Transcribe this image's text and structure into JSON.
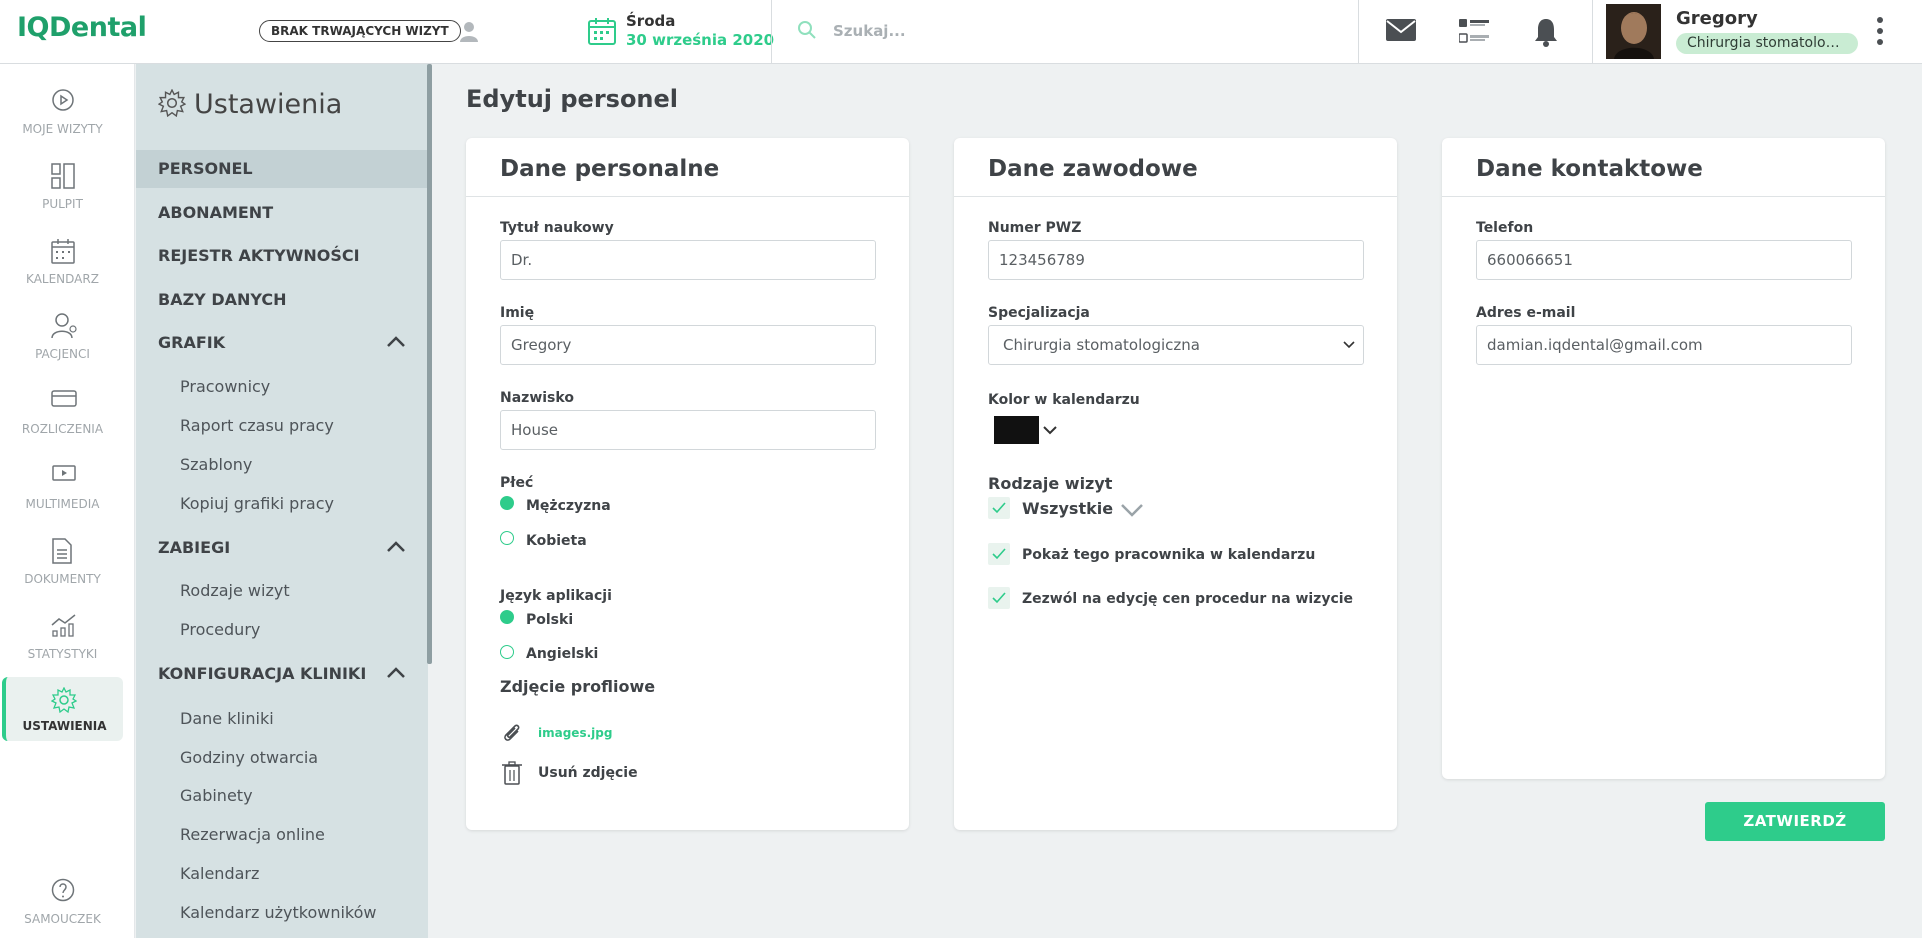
{
  "header": {
    "logo": "IQDental",
    "visit_pill": "BRAK TRWAJĄCYCH WIZYT",
    "day": "Środa",
    "date": "30 września 2020",
    "search_placeholder": "Szukaj...",
    "profile_name": "Gregory",
    "profile_specialization": "Chirurgia stomatologiczna"
  },
  "rail": {
    "items": [
      {
        "label": "MOJE WIZYTY",
        "icon": "play-icon"
      },
      {
        "label": "PULPIT",
        "icon": "dashboard-icon"
      },
      {
        "label": "KALENDARZ",
        "icon": "calendar-icon"
      },
      {
        "label": "PACJENCI",
        "icon": "patients-icon"
      },
      {
        "label": "ROZLICZENIA",
        "icon": "card-icon"
      },
      {
        "label": "MULTIMEDIA",
        "icon": "multimedia-icon"
      },
      {
        "label": "DOKUMENTY",
        "icon": "document-icon"
      },
      {
        "label": "STATYSTYKI",
        "icon": "stats-icon"
      },
      {
        "label": "USTAWIENIA",
        "icon": "gear-icon"
      },
      {
        "label": "SAMOUCZEK",
        "icon": "help-icon"
      }
    ]
  },
  "settings": {
    "title": "Ustawienia",
    "sections": {
      "personel": "PERSONEL",
      "abonament": "ABONAMENT",
      "rejestr": "REJESTR AKTYWNOŚCI",
      "bazy": "BAZY DANYCH",
      "grafik": "GRAFIK",
      "zabiegi": "ZABIEGI",
      "konfiguracja": "KONFIGURACJA KLINIKI"
    },
    "grafik_items": [
      "Pracownicy",
      "Raport czasu pracy",
      "Szablony",
      "Kopiuj grafiki pracy"
    ],
    "zabiegi_items": [
      "Rodzaje wizyt",
      "Procedury"
    ],
    "konfiguracja_items": [
      "Dane kliniki",
      "Godziny otwarcia",
      "Gabinety",
      "Rezerwacja online",
      "Kalendarz",
      "Kalendarz użytkowników"
    ]
  },
  "page": {
    "title": "Edytuj personel",
    "confirm_button": "ZATWIERDŹ"
  },
  "personal": {
    "title": "Dane personalne",
    "academic_title_label": "Tytuł naukowy",
    "academic_title_value": "Dr.",
    "first_name_label": "Imię",
    "first_name_value": "Gregory",
    "last_name_label": "Nazwisko",
    "last_name_value": "House",
    "gender_label": "Płeć",
    "gender_male": "Mężczyzna",
    "gender_female": "Kobieta",
    "language_label": "Język aplikacji",
    "language_polish": "Polski",
    "language_english": "Angielski",
    "photo_label": "Zdjęcie profliowe",
    "photo_file": "images.jpg",
    "remove_photo": "Usuń zdjęcie"
  },
  "professional": {
    "title": "Dane zawodowe",
    "pwz_label": "Numer PWZ",
    "pwz_value": "123456789",
    "spec_label": "Specjalizacja",
    "spec_value": "Chirurgia stomatologiczna",
    "color_label": "Kolor w kalendarzu",
    "color_value": "#111111",
    "visit_types_label": "Rodzaje wizyt",
    "visit_types_value": "Wszystkie",
    "show_in_calendar": "Pokaż tego pracownika w kalendarzu",
    "allow_price_edit": "Zezwól na edycję cen procedur na wizycie"
  },
  "contact": {
    "title": "Dane kontaktowe",
    "phone_label": "Telefon",
    "phone_value": "660066651",
    "email_label": "Adres e-mail",
    "email_value": "damian.iqdental@gmail.com"
  }
}
